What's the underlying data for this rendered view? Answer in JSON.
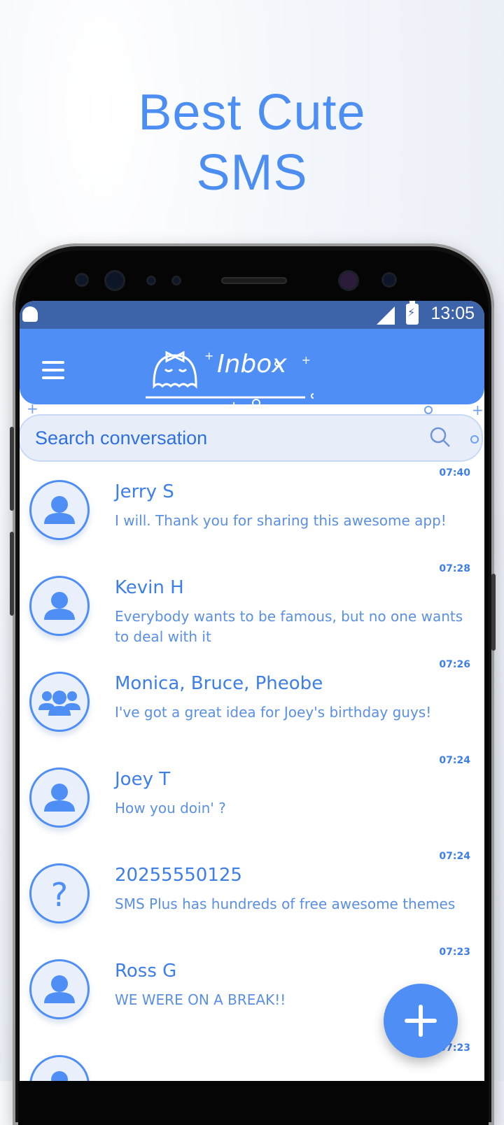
{
  "promo": {
    "line1": "Best Cute",
    "line2": "SMS"
  },
  "status_bar": {
    "time": "13:05"
  },
  "app_bar": {
    "title": "Inbox"
  },
  "search": {
    "placeholder": "Search conversation"
  },
  "conversations": [
    {
      "name": "Jerry S",
      "message": "I will. Thank you for sharing this awesome app!",
      "time": "07:40",
      "avatar": "person-icon"
    },
    {
      "name": "Kevin H",
      "message": "Everybody wants to be famous, but no one wants to deal with it",
      "time": "07:28",
      "avatar": "person-icon"
    },
    {
      "name": "Monica, Bruce, Pheobe",
      "message": "I've got a great idea for Joey's birthday guys!",
      "time": "07:26",
      "avatar": "group-icon"
    },
    {
      "name": "Joey T",
      "message": "How you doin' ?",
      "time": "07:24",
      "avatar": "person-icon"
    },
    {
      "name": "20255550125",
      "message": "SMS Plus has hundreds of free awesome themes",
      "time": "07:24",
      "avatar": "question-mark-icon"
    },
    {
      "name": "Ross G",
      "message": "WE WERE ON A BREAK!!",
      "time": "07:23",
      "avatar": "person-icon"
    },
    {
      "name": "",
      "message": "",
      "time": "07:23",
      "avatar": "person-icon"
    }
  ],
  "colors": {
    "accent": "#4f8ff5",
    "status_bar": "#3d63a8",
    "text": "#3e7ee9"
  }
}
